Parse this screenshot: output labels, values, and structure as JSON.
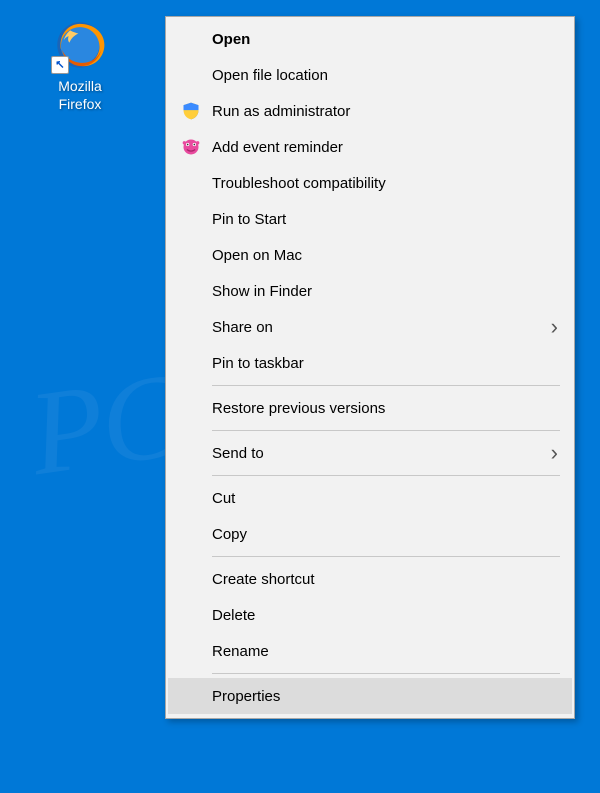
{
  "desktop": {
    "icon_label": "Mozilla Firefox"
  },
  "menu": {
    "groups": [
      [
        {
          "label": "Open",
          "icon": null,
          "bold": true,
          "submenu": false
        },
        {
          "label": "Open file location",
          "icon": null,
          "bold": false,
          "submenu": false
        },
        {
          "label": "Run as administrator",
          "icon": "shield",
          "bold": false,
          "submenu": false
        },
        {
          "label": "Add event reminder",
          "icon": "reminder",
          "bold": false,
          "submenu": false
        },
        {
          "label": "Troubleshoot compatibility",
          "icon": null,
          "bold": false,
          "submenu": false
        },
        {
          "label": "Pin to Start",
          "icon": null,
          "bold": false,
          "submenu": false
        },
        {
          "label": "Open on Mac",
          "icon": null,
          "bold": false,
          "submenu": false
        },
        {
          "label": "Show in Finder",
          "icon": null,
          "bold": false,
          "submenu": false
        },
        {
          "label": "Share on",
          "icon": null,
          "bold": false,
          "submenu": true
        },
        {
          "label": "Pin to taskbar",
          "icon": null,
          "bold": false,
          "submenu": false
        }
      ],
      [
        {
          "label": "Restore previous versions",
          "icon": null,
          "bold": false,
          "submenu": false
        }
      ],
      [
        {
          "label": "Send to",
          "icon": null,
          "bold": false,
          "submenu": true
        }
      ],
      [
        {
          "label": "Cut",
          "icon": null,
          "bold": false,
          "submenu": false
        },
        {
          "label": "Copy",
          "icon": null,
          "bold": false,
          "submenu": false
        }
      ],
      [
        {
          "label": "Create shortcut",
          "icon": null,
          "bold": false,
          "submenu": false
        },
        {
          "label": "Delete",
          "icon": null,
          "bold": false,
          "submenu": false
        },
        {
          "label": "Rename",
          "icon": null,
          "bold": false,
          "submenu": false
        }
      ],
      [
        {
          "label": "Properties",
          "icon": null,
          "bold": false,
          "submenu": false,
          "hover": true
        }
      ]
    ]
  },
  "watermark": "PCrisk.com"
}
